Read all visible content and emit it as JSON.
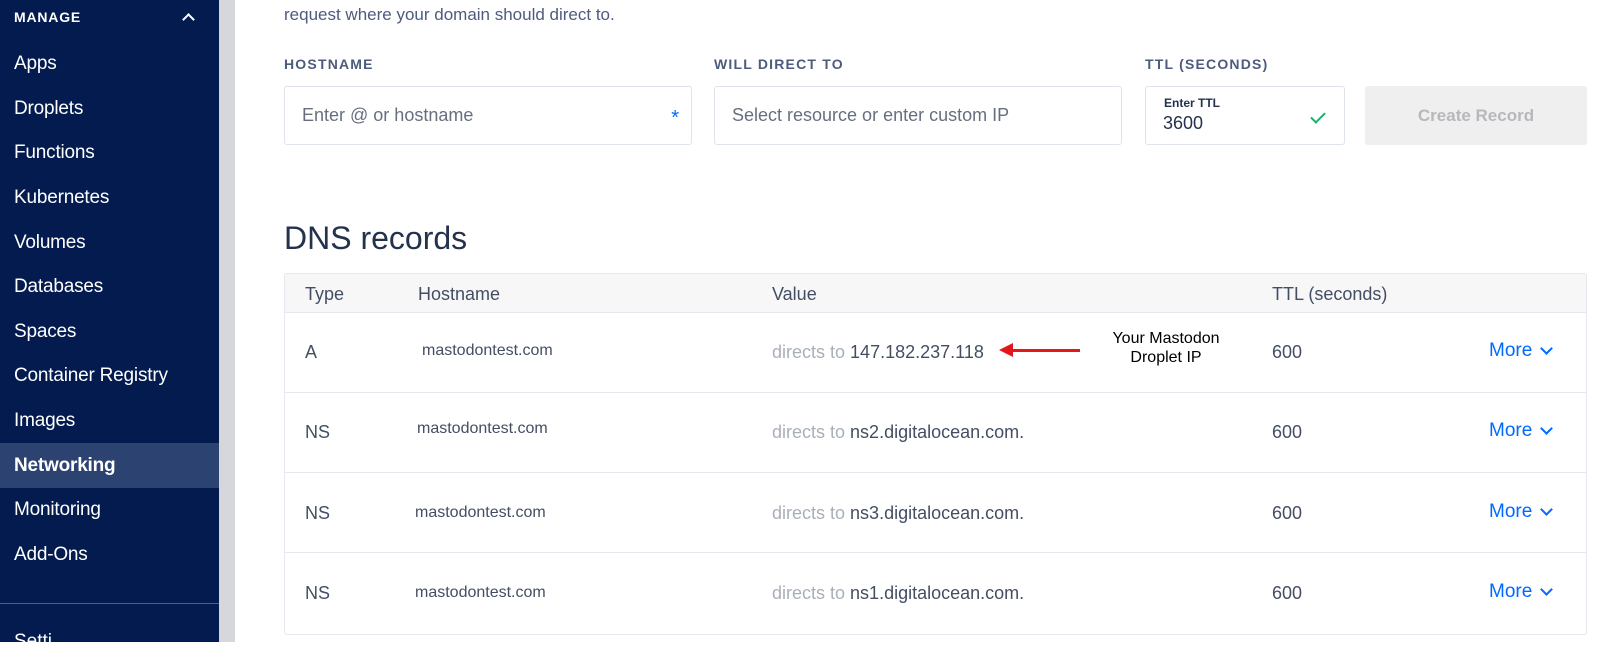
{
  "sidebar": {
    "section_title": "MANAGE",
    "items": [
      {
        "label": "Apps"
      },
      {
        "label": "Droplets"
      },
      {
        "label": "Functions"
      },
      {
        "label": "Kubernetes"
      },
      {
        "label": "Volumes"
      },
      {
        "label": "Databases"
      },
      {
        "label": "Spaces"
      },
      {
        "label": "Container Registry"
      },
      {
        "label": "Images"
      },
      {
        "label": "Networking"
      },
      {
        "label": "Monitoring"
      },
      {
        "label": "Add-Ons"
      }
    ],
    "active": "Networking",
    "next_section_partial": "Setti"
  },
  "form": {
    "intro_text": "request where your domain should direct to.",
    "hostname": {
      "label": "HOSTNAME",
      "placeholder": "Enter @ or hostname",
      "required_mark": "*"
    },
    "direct": {
      "label": "WILL DIRECT TO",
      "placeholder": "Select resource or enter custom IP"
    },
    "ttl": {
      "label": "TTL (SECONDS)",
      "inner_label": "Enter TTL",
      "value": "3600"
    },
    "create_label": "Create Record"
  },
  "dns": {
    "title": "DNS records",
    "columns": {
      "type": "Type",
      "hostname": "Hostname",
      "value": "Value",
      "ttl": "TTL (seconds)"
    },
    "directs_prefix": "directs to",
    "more_label": "More",
    "rows": [
      {
        "type": "A",
        "hostname": "mastodontest.com",
        "value": "147.182.237.118",
        "ttl": "600"
      },
      {
        "type": "NS",
        "hostname": "mastodontest.com",
        "value": "ns2.digitalocean.com.",
        "ttl": "600"
      },
      {
        "type": "NS",
        "hostname": "mastodontest.com",
        "value": "ns3.digitalocean.com.",
        "ttl": "600"
      },
      {
        "type": "NS",
        "hostname": "mastodontest.com",
        "value": "ns1.digitalocean.com.",
        "ttl": "600"
      }
    ]
  },
  "annotation": {
    "line1": "Your Mastodon",
    "line2": "Droplet IP",
    "color": "#e3161b"
  },
  "colors": {
    "sidebar_bg": "#031b4e",
    "sidebar_active": "#2c4372",
    "accent": "#0069ff",
    "success": "#15b26b"
  }
}
